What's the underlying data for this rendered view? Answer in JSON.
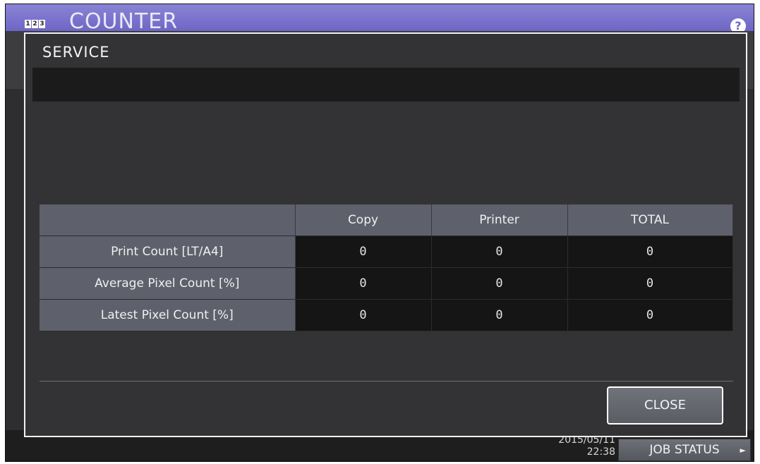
{
  "app": {
    "icon_digits": [
      "1",
      "2",
      "3"
    ],
    "title": "COUNTER",
    "help_icon": "?"
  },
  "dialog": {
    "title": "SERVICE",
    "message": "",
    "table": {
      "columns": [
        "",
        "Copy",
        "Printer",
        "TOTAL"
      ],
      "rows": [
        {
          "label": "Print Count [LT/A4]",
          "values": [
            "0",
            "0",
            "0"
          ]
        },
        {
          "label": "Average Pixel Count [%]",
          "values": [
            "0",
            "0",
            "0"
          ]
        },
        {
          "label": "Latest Pixel Count [%]",
          "values": [
            "0",
            "0",
            "0"
          ]
        }
      ]
    },
    "close_label": "CLOSE"
  },
  "footer": {
    "date": "2015/05/11",
    "time": "22:38",
    "job_status_label": "JOB STATUS",
    "job_status_arrow": "►"
  },
  "colors": {
    "header_accent": "#7a73cd",
    "dialog_background": "#333335",
    "table_header": "#5e616b",
    "value_cell": "#151516"
  }
}
